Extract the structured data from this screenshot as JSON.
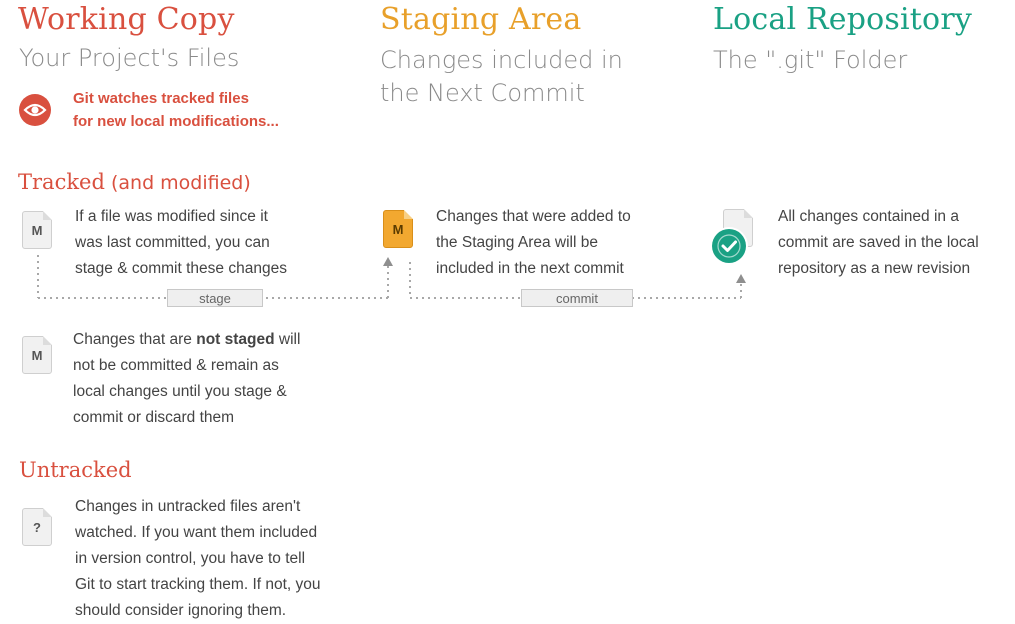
{
  "columns": {
    "working": {
      "title": "Working Copy",
      "subtitle": "Your Project's Files"
    },
    "staging": {
      "title": "Staging Area",
      "subtitle_line1": "Changes included in",
      "subtitle_line2": "the Next Commit"
    },
    "repo": {
      "title": "Local Repository",
      "subtitle": "The \".git\" Folder"
    }
  },
  "watch_note": {
    "line1": "Git watches tracked files",
    "line2": "for new local modifications..."
  },
  "tracked": {
    "heading_main": "Tracked",
    "heading_paren": " (and modified)",
    "modified": {
      "icon_label": "M",
      "line1": "If a file was modified since it",
      "line2": "was last committed, you can",
      "line3": "stage & commit these changes"
    },
    "not_staged": {
      "icon_label": "M",
      "line1_pre": "Changes that are ",
      "line1_bold": "not staged",
      "line1_post": " will",
      "line2": "not be committed & remain as",
      "line3": "local changes until you stage &",
      "line4": "commit or discard them"
    }
  },
  "staging_note": {
    "icon_label": "M",
    "line1": "Changes that were added to",
    "line2": "the Staging Area will be",
    "line3": "included in the next commit"
  },
  "repo_note": {
    "line1": "All changes contained in a",
    "line2": "commit are saved in the local",
    "line3": "repository as a new revision"
  },
  "connectors": {
    "stage_label": "stage",
    "commit_label": "commit"
  },
  "untracked": {
    "heading": "Untracked",
    "icon_label": "?",
    "line1": "Changes in untracked files aren't",
    "line2": "watched. If you want them included",
    "line3": "in version control, you have to tell",
    "line4": "Git to start tracking them. If not, you",
    "line5": "should consider ignoring them."
  },
  "colors": {
    "red": "#d9503f",
    "orange": "#e8a02a",
    "teal": "#1aa184",
    "gray": "#8a8a8a"
  },
  "icons": [
    "eye-icon",
    "modified-file-icon",
    "staged-file-icon",
    "committed-check-icon",
    "untracked-file-icon",
    "arrow-up-icon"
  ]
}
